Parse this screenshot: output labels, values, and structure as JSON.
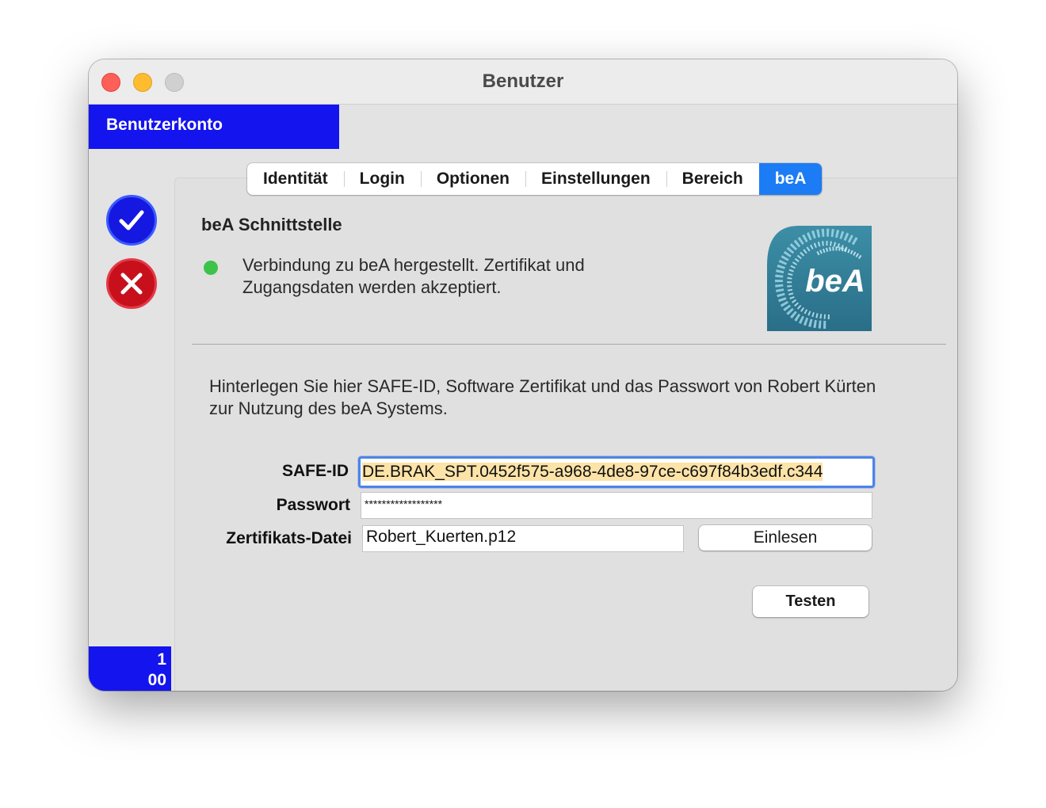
{
  "window": {
    "title": "Benutzer"
  },
  "header": {
    "label": "Benutzerkonto"
  },
  "sidebar": {
    "counter_line1": "1",
    "counter_line2": "00"
  },
  "tabs": [
    {
      "label": "Identität"
    },
    {
      "label": "Login"
    },
    {
      "label": "Optionen"
    },
    {
      "label": "Einstellungen"
    },
    {
      "label": "Bereich"
    },
    {
      "label": "beA"
    }
  ],
  "active_tab": "beA",
  "bea": {
    "section_title": "beA Schnittstelle",
    "status_text": "Verbindung zu beA hergestellt. Zertifikat und Zugangsdaten werden akzeptiert.",
    "status_color": "#3dc24a",
    "logo_text": "beA",
    "intro": "Hinterlegen Sie hier SAFE-ID, Software Zertifikat und das Passwort von Robert Kürten zur Nutzung des beA Systems."
  },
  "form": {
    "safe_id_label": "SAFE-ID",
    "safe_id_value": "DE.BRAK_SPT.0452f575-a968-4de8-97ce-c697f84b3edf.c344",
    "password_label": "Passwort",
    "password_value": "******************",
    "cert_label": "Zertifikats-Datei",
    "cert_value": "Robert_Kuerten.p12",
    "read_button": "Einlesen",
    "test_button": "Testen"
  },
  "colors": {
    "accent_blue": "#1414ee",
    "tab_active": "#1b7cf5",
    "ok_button": "#1518e0",
    "cancel_button": "#c8101d"
  }
}
